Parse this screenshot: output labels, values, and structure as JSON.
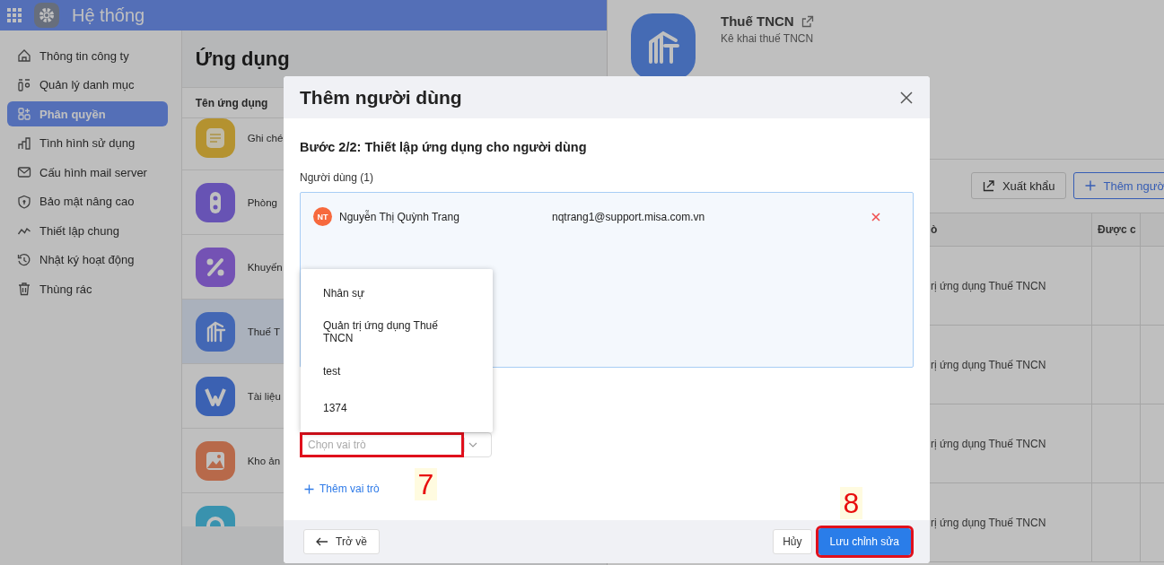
{
  "header": {
    "title": "Hệ thống"
  },
  "sidebar": {
    "items": [
      {
        "label": "Thông tin công ty",
        "selected": false
      },
      {
        "label": "Quản lý danh mục",
        "selected": false
      },
      {
        "label": "Phân quyền",
        "selected": true
      },
      {
        "label": "Tình hình sử dụng",
        "selected": false
      },
      {
        "label": "Cấu hình mail server",
        "selected": false
      },
      {
        "label": "Bảo mật nâng cao",
        "selected": false
      },
      {
        "label": "Thiết lập chung",
        "selected": false
      },
      {
        "label": "Nhật ký hoạt động",
        "selected": false
      },
      {
        "label": "Thùng rác",
        "selected": false
      }
    ]
  },
  "apps": {
    "title": "Ứng dụng",
    "column": "Tên ứng dụng",
    "rows": [
      {
        "name": "Ghi ché",
        "selected": false
      },
      {
        "name": "Phòng",
        "selected": false
      },
      {
        "name": "Khuyến",
        "selected": false
      },
      {
        "name": "Thuế T",
        "selected": true
      },
      {
        "name": "Tài liệu",
        "selected": false
      },
      {
        "name": "Kho ản",
        "selected": false
      },
      {
        "selected": false
      }
    ]
  },
  "detail": {
    "title": "Thuế TNCN",
    "subtitle": "Kê khai thuế TNCN",
    "buttons": [
      {
        "label": "Xuất khẩu",
        "kind": "export"
      },
      {
        "label": "Thêm ngườ",
        "kind": "add"
      }
    ],
    "table": {
      "columns": [
        "ò",
        "Được c"
      ],
      "rows": [
        [
          "rị ứng dụng Thuế TNCN"
        ],
        [
          "rị ứng dụng Thuế TNCN"
        ],
        [
          "rị ứng dụng Thuế TNCN"
        ],
        [
          "rị ứng dụng Thuế TNCN"
        ]
      ]
    }
  },
  "modal": {
    "title": "Thêm người dùng",
    "step": "Bước 2/2: Thiết lập ứng dụng cho người dùng",
    "users_label": "Người dùng (1)",
    "users": [
      {
        "initials": "NT",
        "name": "Nguyễn Thị Quỳnh Trang",
        "email": "nqtrang1@support.misa.com.vn"
      }
    ],
    "role_options": [
      "Nhân sự",
      "Quản trị ứng dụng Thuế TNCN",
      "test",
      "1374"
    ],
    "role_field": {
      "placeholder": "Chọn vai trò",
      "highlighted": true
    },
    "add_role": "Thêm vai trò",
    "back_button": "Trở về",
    "cancel_button": "Hủy",
    "save_button": {
      "label": "Lưu chỉnh sửa",
      "highlighted": true
    }
  },
  "annotations": [
    {
      "label": "7"
    },
    {
      "label": "8"
    }
  ]
}
